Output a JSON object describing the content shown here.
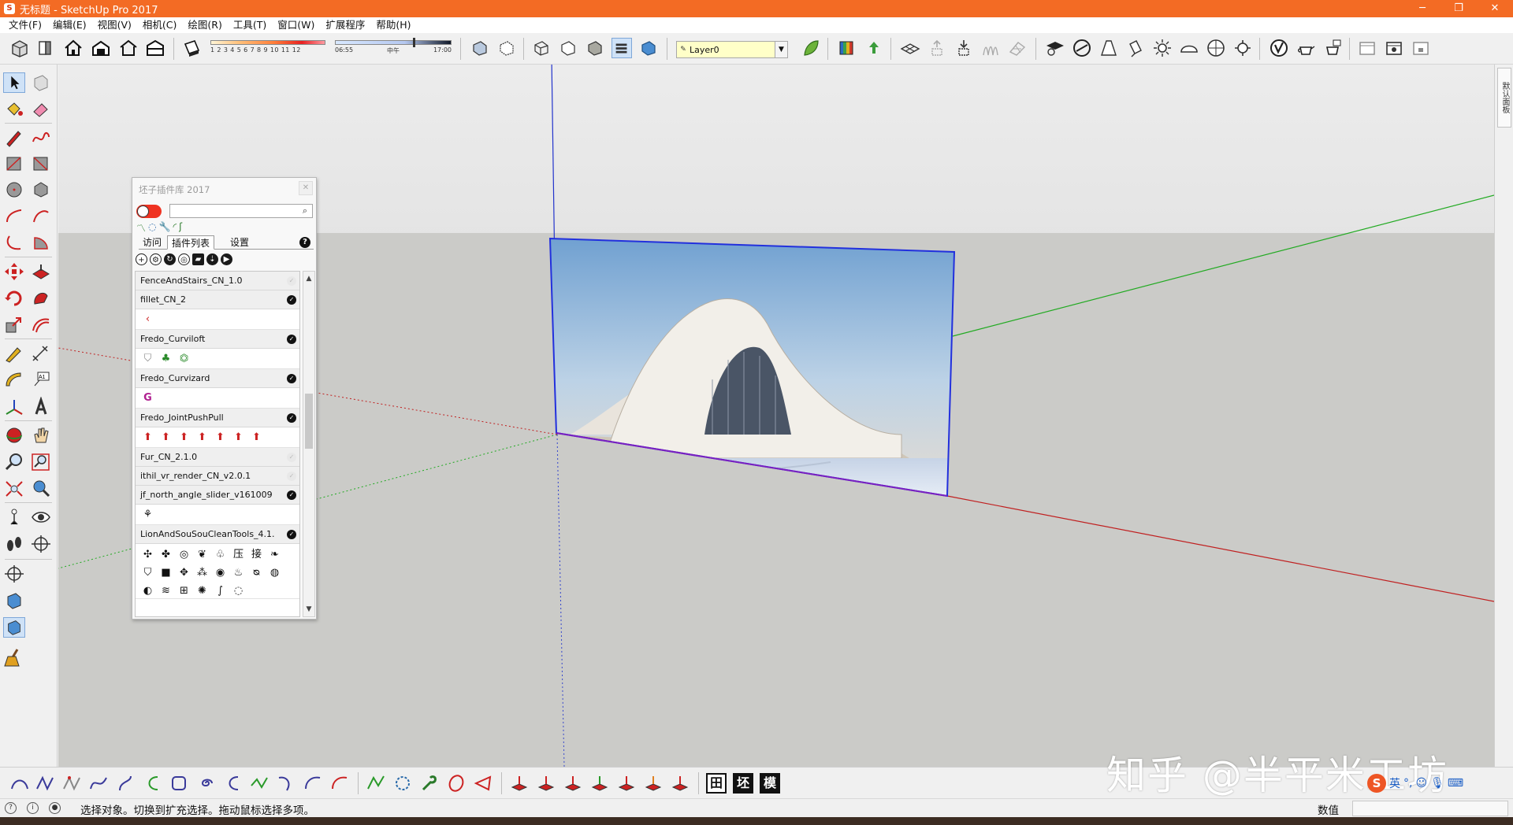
{
  "window": {
    "app_icon": "sketchup-icon",
    "title": "无标题 - SketchUp Pro 2017",
    "controls": [
      "minimize-icon",
      "maximize-icon",
      "close-icon"
    ]
  },
  "menu": [
    "文件(F)",
    "编辑(E)",
    "视图(V)",
    "相机(C)",
    "绘图(R)",
    "工具(T)",
    "窗口(W)",
    "扩展程序",
    "帮助(H)"
  ],
  "toolbar": {
    "shadow_scale_numbers": "1 2 3 4 5 6 7 8 9 10 11 12",
    "time_start": "06:55",
    "time_mid": "中午",
    "time_end": "17:00",
    "layer": "Layer0"
  },
  "right_tray": {
    "tab_label": "默认面板"
  },
  "plugin_panel": {
    "title": "坯子插件库 2017",
    "tabs": [
      "访问",
      "插件列表",
      "设置"
    ],
    "active_tab": "插件列表",
    "help": "?",
    "plugins": [
      {
        "name": "FenceAndStairs_CN_1.0",
        "enabled": false,
        "icons": []
      },
      {
        "name": "fillet_CN_2",
        "enabled": true,
        "icons": [
          "fillet-curve-icon"
        ]
      },
      {
        "name": "Fredo_Curviloft",
        "enabled": true,
        "icons": [
          "loft-icon",
          "skin-icon",
          "path-loft-icon"
        ]
      },
      {
        "name": "Fredo_Curvizard",
        "enabled": true,
        "icons": [
          "curvizard-icon"
        ]
      },
      {
        "name": "Fredo_JointPushPull",
        "enabled": true,
        "icons": [
          "jpp-icon",
          "jpp-j-icon",
          "jpp-r-icon",
          "jpp-v-icon",
          "jpp-n-icon",
          "jpp-x-icon",
          "jpp-f-icon"
        ]
      },
      {
        "name": "Fur_CN_2.1.0",
        "enabled": false,
        "icons": []
      },
      {
        "name": "ithil_vr_render_CN_v2.0.1",
        "enabled": false,
        "icons": []
      },
      {
        "name": "jf_north_angle_slider_v161009",
        "enabled": true,
        "icons": [
          "north-angle-icon"
        ]
      },
      {
        "name": "LionAndSouSouCleanTools_4.1.",
        "enabled": true,
        "icons": [
          "clean-1-icon",
          "clean-2-icon",
          "clean-3-icon",
          "clean-4-icon",
          "clean-5-icon",
          "clean-6-icon",
          "clean-7-icon",
          "clean-8-icon",
          "clean-9-icon",
          "clean-10-icon",
          "clean-11-icon",
          "clean-12-icon",
          "clean-13-icon",
          "clean-14-icon",
          "clean-15-icon",
          "clean-16-icon",
          "clean-17-icon",
          "clean-18-icon",
          "clean-19-icon",
          "clean-20-icon",
          "clean-21-icon"
        ]
      }
    ],
    "grid_glyphs": [
      "✣",
      "✤",
      "◎",
      "❦",
      "♧",
      "压",
      "接",
      "❧",
      "⛉",
      "■",
      "✥",
      "⁂",
      "◉",
      "♨",
      "ᴓ",
      "◍",
      "◐",
      "≋",
      "⊞",
      "✺",
      "∫",
      "◌"
    ]
  },
  "bottom_toolbar": {
    "boxes": [
      "田",
      "坯",
      "模"
    ]
  },
  "watermark": "知乎 @半平米工坊",
  "ime": {
    "lang": "英"
  },
  "status": {
    "message": "选择对象。切换到扩充选择。拖动鼠标选择多项。",
    "value_label": "数值",
    "value": ""
  }
}
